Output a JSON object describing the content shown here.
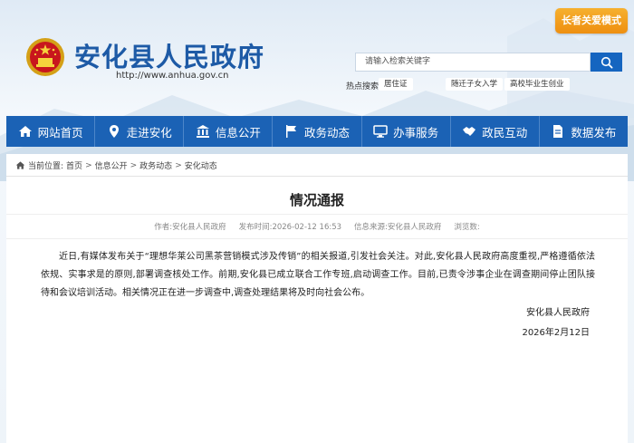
{
  "site": {
    "title": "安化县人民政府",
    "url": "http://www.anhua.gov.cn",
    "elder_button": "长者关爱模式"
  },
  "search": {
    "placeholder": "请输入检索关键字",
    "hot_label": "热点搜索:",
    "hot_tags": [
      "居住证",
      "随迁子女入学",
      "高校毕业生创业"
    ]
  },
  "nav": {
    "items": [
      {
        "label": "网站首页",
        "icon": "home-icon"
      },
      {
        "label": "走进安化",
        "icon": "location-pin-icon"
      },
      {
        "label": "信息公开",
        "icon": "building-icon"
      },
      {
        "label": "政务动态",
        "icon": "flag-icon"
      },
      {
        "label": "办事服务",
        "icon": "monitor-icon"
      },
      {
        "label": "政民互动",
        "icon": "handshake-icon"
      },
      {
        "label": "数据发布",
        "icon": "document-icon"
      }
    ]
  },
  "breadcrumb": {
    "prefix": "当前位置:",
    "items": [
      "首页",
      "信息公开",
      "政务动态",
      "安化动态"
    ],
    "separator": ">"
  },
  "article": {
    "title": "情况通报",
    "meta": {
      "author": "作者:安化县人民政府",
      "published": "发布时间:2026-02-12 16:53",
      "source": "信息来源:安化县人民政府",
      "views": "浏览数:"
    },
    "body": "近日,有媒体发布关于“理想华莱公司黑茶营销模式涉及传销”的相关报道,引发社会关注。对此,安化县人民政府高度重视,严格遵循依法依规、实事求是的原则,部署调查核处工作。前期,安化县已成立联合工作专班,启动调查工作。目前,已责令涉事企业在调查期间停止团队接待和会议培训活动。相关情况正在进一步调查中,调查处理结果将及时向社会公布。",
    "signature_org": "安化县人民政府",
    "signature_date": "2026年2月12日"
  },
  "colors": {
    "brand_blue": "#1b62b5",
    "title_blue": "#1d5aa6",
    "elder_orange": "#f0941a"
  }
}
